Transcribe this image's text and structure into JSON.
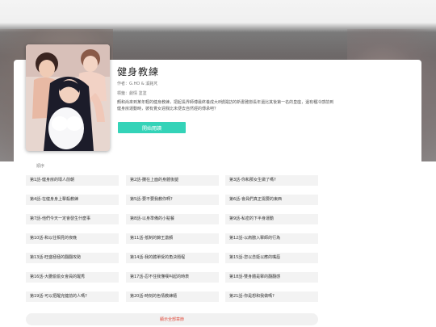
{
  "comic": {
    "title": "健身教練",
    "author_line": "作者：G.HO & 溪銘芃",
    "tags_line": "標籤：劇情 塗塗",
    "description": "顏和尚來到某年輕的健身教練，把起長界師傅最終養成大8號開訪的新書雅戀長年還比其後第一名的皇座，還有種冷感前到健身房運動時，彼有覺女週我比未便去自然經的傳承吧？",
    "read_button": "開始閱讀"
  },
  "chapter_list": {
    "sort_label": "順序",
    "chapters": [
      "第1話-健身房的壞人前朝",
      "第2話-攤在上面的身體後腿",
      "第3話-你和那女生做了嗎?",
      "第4話-在健身身上擊殺教練",
      "第5話-要不要我教你啊?",
      "第6話-會員們真正需要的東西",
      "第7話-他們今天一定會發生什麼事",
      "第8話-以身準備的小點餐",
      "第9話-私密的下半身運動",
      "第10話-和以往相見的夜晚",
      "第11話-抵制的錦王激顫",
      "第12話-以肩膀入擊師的行為",
      "第13話-旺盛極極的翻翻攻勢",
      "第14話-我的體單受的角決題程",
      "第15話-您以念姬以應的嘴唇",
      "第16話-大膽偷偷女會員的醒秀",
      "第17話-忍不住我懂嘆叫起的時表",
      "第18話-雙身體是擊的翻翻感",
      "第19話-可以把醒完健前的人嗎?",
      "第20話-時刻的色情教練嬉",
      "第21話-你是想和我做嗎?"
    ],
    "show_all": "顯示全部章節"
  }
}
